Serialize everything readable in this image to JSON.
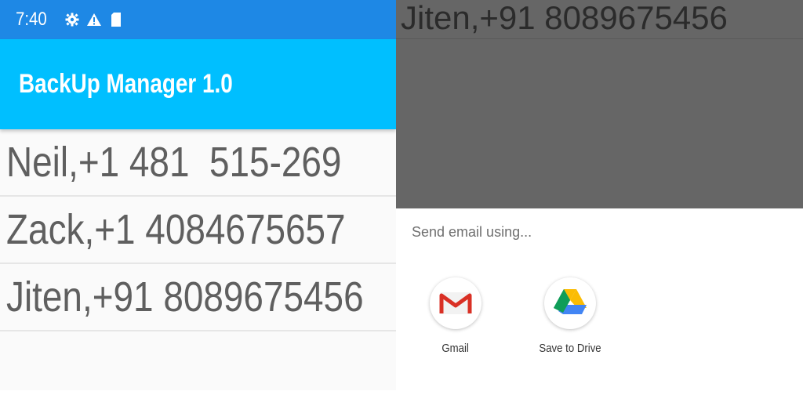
{
  "status_bar": {
    "time": "7:40",
    "icons": [
      "settings-gear-icon",
      "warning-icon",
      "sim-card-icon"
    ],
    "color": "#1e88e5"
  },
  "app_bar": {
    "title": "BackUp Manager 1.0",
    "color": "#00bfff"
  },
  "contacts": [
    {
      "text": "Neil,+1 481  515-269"
    },
    {
      "text": "Zack,+1 4084675657"
    },
    {
      "text": "Jiten,+91 8089675456"
    }
  ],
  "dimmed_background": {
    "row_text": "Jiten,+91 8089675456",
    "scrim_color": "#666666"
  },
  "share_sheet": {
    "title": "Send email using...",
    "targets": [
      {
        "label": "Gmail",
        "icon": "gmail-icon"
      },
      {
        "label": "Save to Drive",
        "icon": "google-drive-icon"
      }
    ]
  }
}
